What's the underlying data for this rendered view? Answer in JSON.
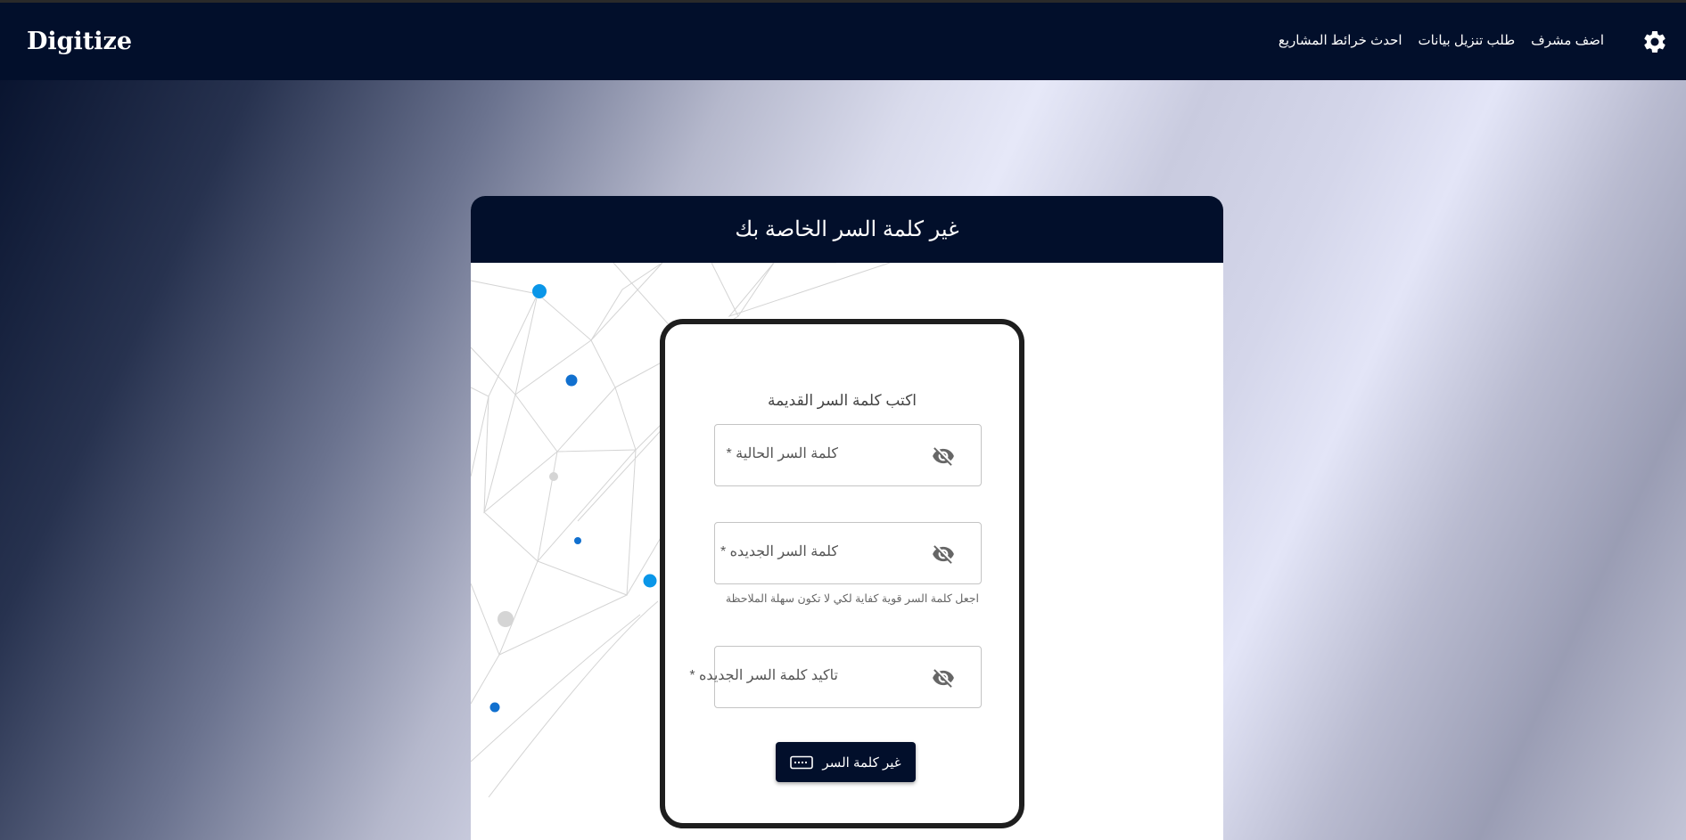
{
  "app": {
    "brand": "Digitize"
  },
  "nav": {
    "items": [
      {
        "label": "اضف مشرف"
      },
      {
        "label": "طلب تنزيل بيانات"
      },
      {
        "label": "احدث خرائط المشاريع"
      }
    ],
    "settings_icon": "gear-icon"
  },
  "card": {
    "title": "غير كلمة السر الخاصة بك"
  },
  "form": {
    "title": "اكتب كلمة السر القديمة",
    "current_password_label": "كلمة السر الحالية *",
    "new_password_label": "كلمة السر الجديده *",
    "new_password_helper": "اجعل كلمة السر قوية كفاية لكي لا تكون سهلة الملاحظة",
    "confirm_password_label": "تاكيد كلمة السر الجديده *",
    "visibility_icon": "eye-off-icon",
    "submit_label": "غير كلمة السر",
    "submit_icon": "keyboard-icon"
  },
  "colors": {
    "navbar": "#020f2b",
    "accent_dots": "#0a8de0"
  }
}
